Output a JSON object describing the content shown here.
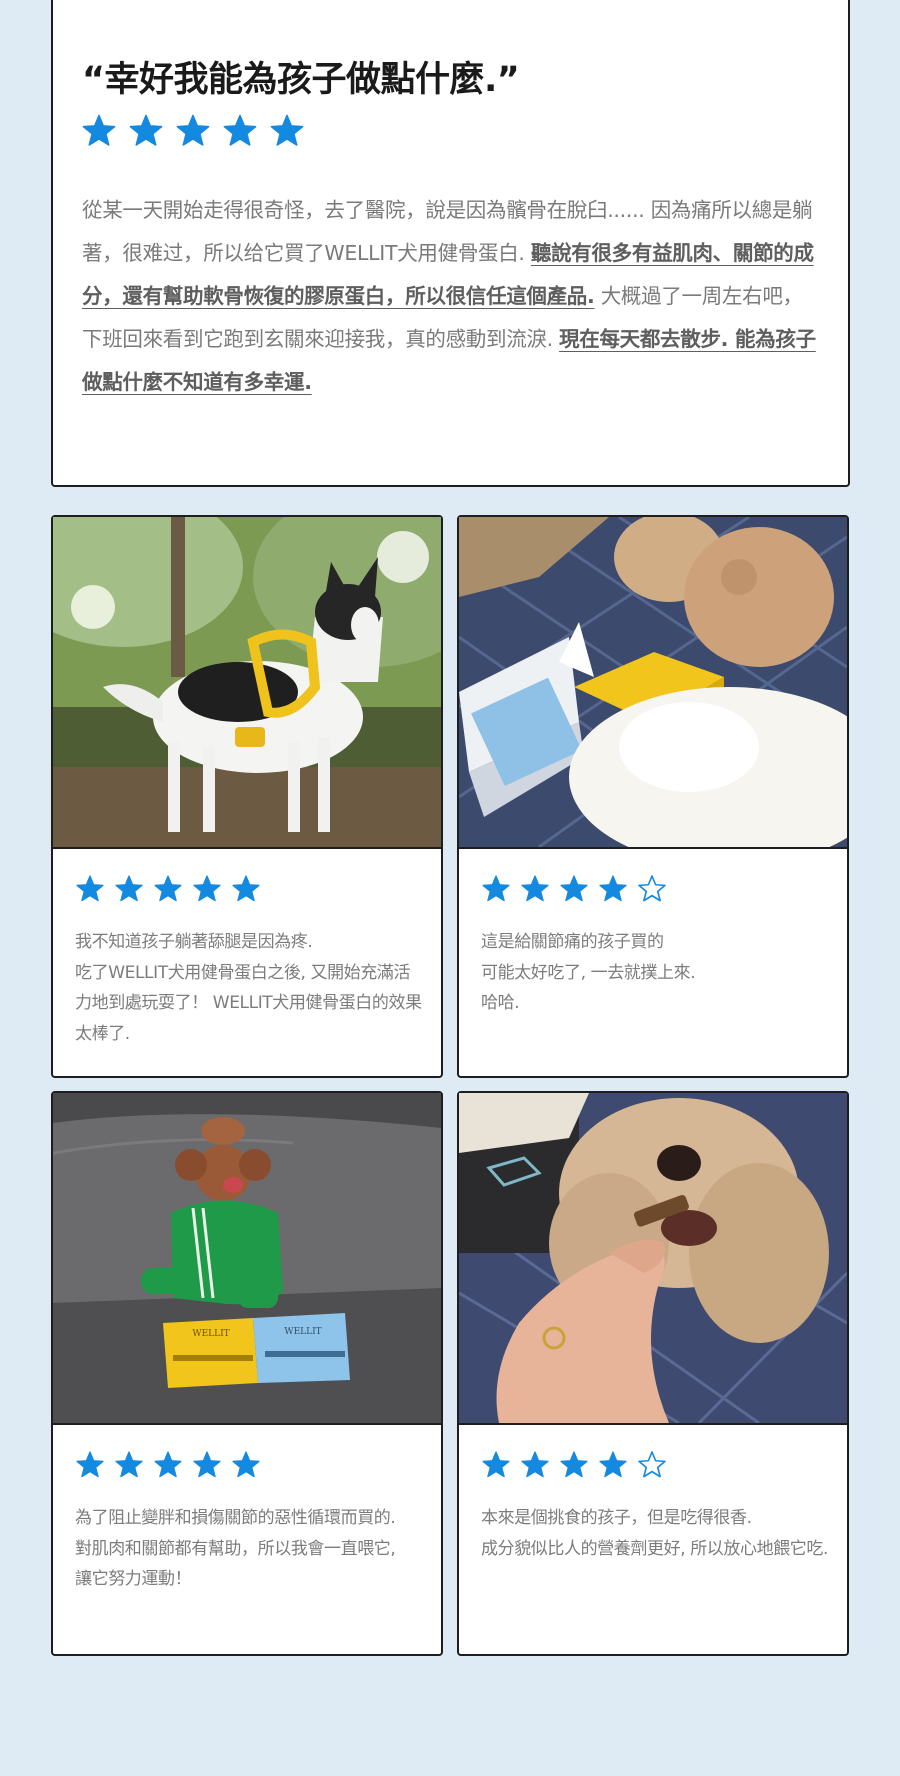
{
  "colors": {
    "background": "#deeaf4",
    "star": "#1489e0",
    "border": "#1e1e1e"
  },
  "hero": {
    "title": "“幸好我能為孩子做點什麼.”",
    "rating": 5,
    "text_1": "從某一天開始走得很奇怪，去了醫院，說是因為髕骨在脫臼...... 因為痛所以總是躺著，很难过，所以给它買了WELLIT犬用健骨蛋白. ",
    "highlight_1": "聽說有很多有益肌肉、關節的成分，還有幫助軟骨恢復的膠原蛋白，所以很信任這個產品.",
    "text_2": " 大概過了一周左右吧，下班回來看到它跑到玄關來迎接我，真的感動到流淚. ",
    "highlight_2": "現在每天都去散步. 能為孩子做點什麼不知道有多幸運."
  },
  "reviews": [
    {
      "rating": 5,
      "photo": "dog-walk-photo",
      "text": "我不知道孩子躺著舔腿是因為疼.\n吃了WELLIT犬用健骨蛋白之後, 又開始充滿活力地到處玩耍了！ WELLIT犬用健骨蛋白的效果太棒了."
    },
    {
      "rating": 4,
      "photo": "dogs-with-boxes-photo",
      "text": "這是給關節痛的孩子買的\n可能太好吃了, 一去就撲上來.\n哈哈."
    },
    {
      "rating": 5,
      "photo": "poodle-sofa-photo",
      "box_labels": [
        "WELLIT",
        "WELLIT"
      ],
      "text": "為了阻止變胖和損傷關節的惡性循環而買的.\n對肌肉和關節都有幫助，所以我會一直喂它,\n讓它努力運動！"
    },
    {
      "rating": 4,
      "photo": "dog-eating-treat-photo",
      "text": "本來是個挑食的孩子，但是吃得很香.\n成分貌似比人的營養劑更好, 所以放心地餵它吃."
    }
  ]
}
